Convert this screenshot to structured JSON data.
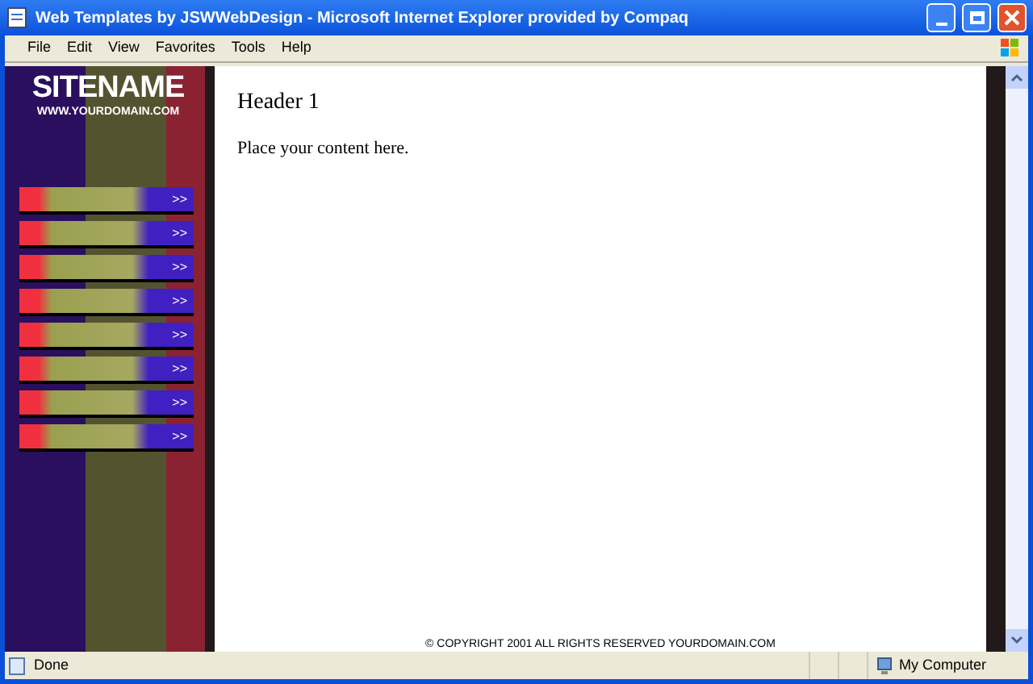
{
  "window": {
    "title": "Web Templates by JSWWebDesign - Microsoft Internet Explorer provided by Compaq"
  },
  "menu": [
    "File",
    "Edit",
    "View",
    "Favorites",
    "Tools",
    "Help"
  ],
  "sidebar": {
    "site_name": "SITENAME",
    "domain": "WWW.YOURDOMAIN.COM",
    "nav_buttons": [
      {
        "label": ">>"
      },
      {
        "label": ">>"
      },
      {
        "label": ">>"
      },
      {
        "label": ">>"
      },
      {
        "label": ">>"
      },
      {
        "label": ">>"
      },
      {
        "label": ">>"
      },
      {
        "label": ">>"
      }
    ]
  },
  "content": {
    "header": "Header 1",
    "body": "Place your content here.",
    "footer": "© COPYRIGHT 2001 ALL RIGHTS RESERVED YOURDOMAIN.COM"
  },
  "status_bar": {
    "status": "Done",
    "zone": "My Computer"
  }
}
